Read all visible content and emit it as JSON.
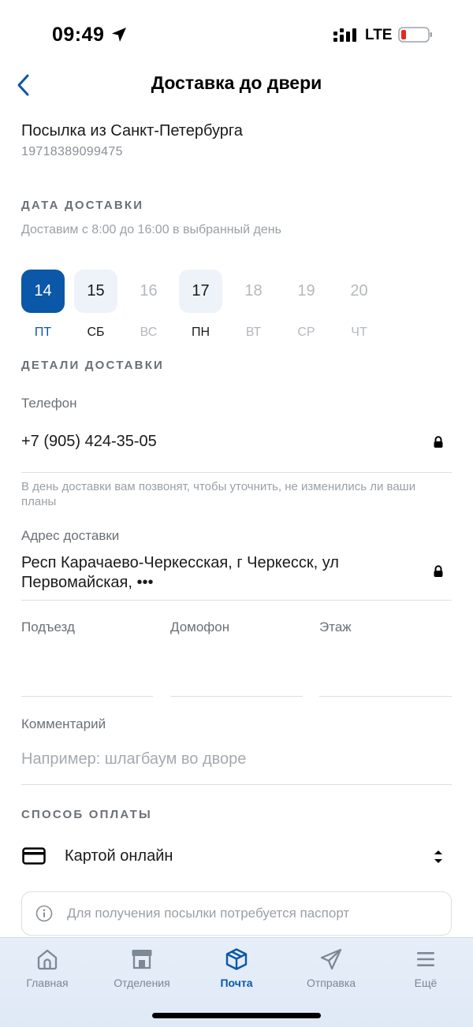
{
  "status_bar": {
    "time": "09:49",
    "network": "LTE"
  },
  "header": {
    "title": "Доставка до двери"
  },
  "parcel": {
    "title": "Посылка из Санкт-Петербурга",
    "number": "19718389099475"
  },
  "delivery_date": {
    "heading": "ДАТА ДОСТАВКИ",
    "hint": "Доставим с 8:00 до 16:00 в выбранный день",
    "days": [
      {
        "day": "14",
        "weekday": "ПТ",
        "state": "selected"
      },
      {
        "day": "15",
        "weekday": "СБ",
        "state": "available"
      },
      {
        "day": "16",
        "weekday": "ВС",
        "state": "disabled"
      },
      {
        "day": "17",
        "weekday": "ПН",
        "state": "available"
      },
      {
        "day": "18",
        "weekday": "ВТ",
        "state": "disabled"
      },
      {
        "day": "19",
        "weekday": "СР",
        "state": "disabled"
      },
      {
        "day": "20",
        "weekday": "ЧТ",
        "state": "disabled"
      }
    ]
  },
  "details": {
    "heading": "ДЕТАЛИ ДОСТАВКИ",
    "phone_label": "Телефон",
    "phone_value": "+7 (905) 424-35-05",
    "phone_hint": "В день доставки вам позвонят, чтобы уточнить, не изменились ли ваши планы",
    "address_label": "Адрес доставки",
    "address_line1": "Респ Карачаево-Черкесская, г Черкесск, ул",
    "address_line2": "Первомайская, •••",
    "entrance_label": "Подъезд",
    "intercom_label": "Домофон",
    "floor_label": "Этаж",
    "comment_label": "Комментарий",
    "comment_placeholder": "Например: шлагбаум во дворе"
  },
  "payment": {
    "heading": "СПОСОБ ОПЛАТЫ",
    "method": "Картой онлайн",
    "notice": "Для получения посылки потребуется паспорт"
  },
  "tabbar": {
    "tabs": [
      {
        "label": "Главная",
        "icon": "home-icon",
        "active": false
      },
      {
        "label": "Отделения",
        "icon": "store-icon",
        "active": false
      },
      {
        "label": "Почта",
        "icon": "package-icon",
        "active": true
      },
      {
        "label": "Отправка",
        "icon": "send-icon",
        "active": false
      },
      {
        "label": "Ещё",
        "icon": "menu-icon",
        "active": false
      }
    ]
  },
  "colors": {
    "accent": "#0b57a8",
    "selected_bg": "#0b57a8",
    "available_bg": "#eef3f9",
    "muted": "#9aa0a6"
  }
}
